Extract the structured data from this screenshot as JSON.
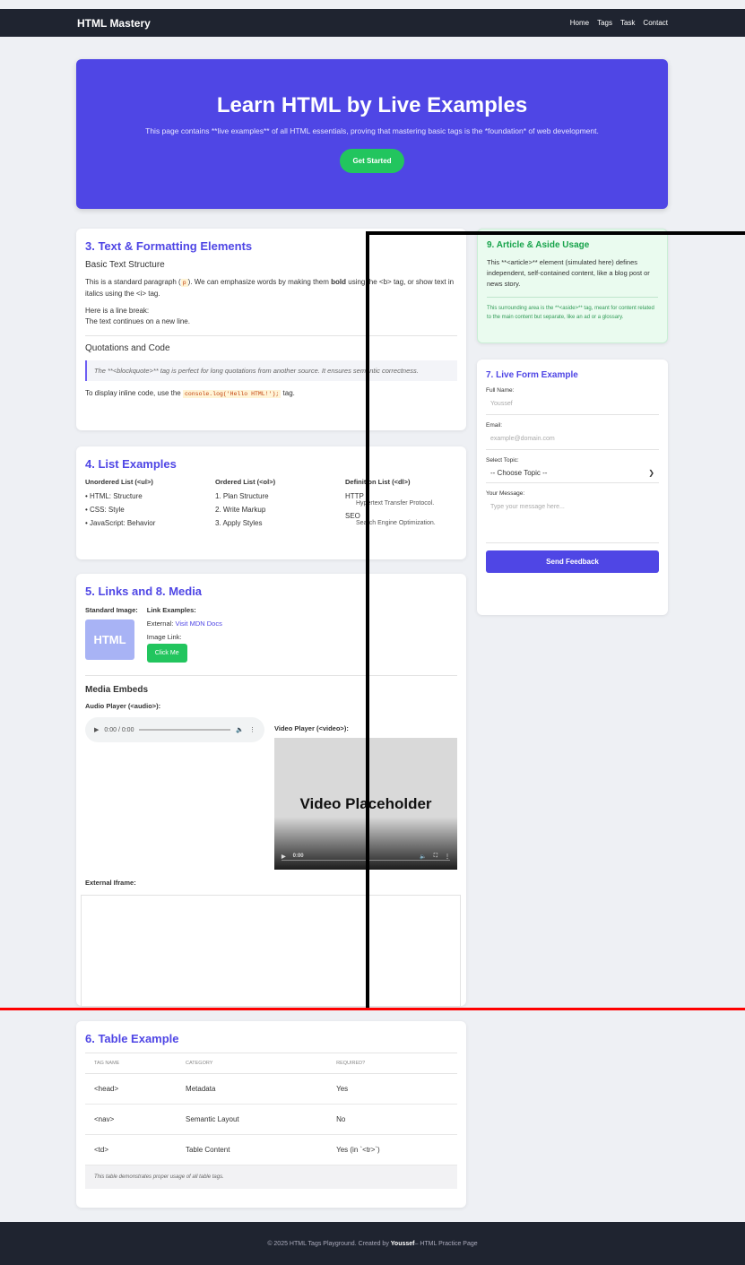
{
  "header": {
    "brand": "HTML Mastery",
    "nav": [
      "Home",
      "Tags",
      "Task",
      "Contact"
    ]
  },
  "hero": {
    "title": "Learn HTML by Live Examples",
    "subtitle": "This page contains **live examples** of all HTML essentials, proving that mastering basic tags is the *foundation* of web development.",
    "cta": "Get Started"
  },
  "text_section": {
    "title": "3. Text & Formatting Elements",
    "basic_heading": "Basic Text Structure",
    "para1_a": "This is a standard paragraph (",
    "para1_code": "p",
    "para1_b": "). We can emphasize words by making them ",
    "para1_bold": "bold",
    "para1_c": " using the <b> tag, or show text in italics using the <i> tag.",
    "br1": "Here is a line break:",
    "br2": "The text continues on a new line.",
    "quote_heading": "Quotations and Code",
    "blockquote": "The **<blockquote>** tag is perfect for long quotations from another source. It ensures semantic correctness.",
    "inline_a": "To display inline code, use the ",
    "inline_code": "console.log('Hello HTML!');",
    "inline_b": " tag."
  },
  "lists": {
    "title": "4. List Examples",
    "ul_heading": "Unordered List (<ul>)",
    "ul_items": [
      "HTML: Structure",
      "CSS: Style",
      "JavaScript: Behavior"
    ],
    "ol_heading": "Ordered List (<ol>)",
    "ol_items": [
      "1. Plan Structure",
      "2. Write Markup",
      "3. Apply Styles"
    ],
    "dl_heading": "Definition List (<dl>)",
    "dl_terms": [
      {
        "term": "HTTP",
        "def": "Hypertext Transfer Protocol."
      },
      {
        "term": "SEO",
        "def": "Search Engine Optimization."
      }
    ]
  },
  "media": {
    "title": "5. Links and 8. Media",
    "std_image": "Standard Image:",
    "img_text": "HTML",
    "link_examples": "Link Examples:",
    "external_label": "External:",
    "external_link": "Visit MDN Docs",
    "image_link_label": "Image Link:",
    "click_me": "Click Me",
    "embeds_heading": "Media Embeds",
    "audio_label": "Audio Player (<audio>):",
    "audio_time": "0:00 / 0:00",
    "video_label": "Video Player (<video>):",
    "video_placeholder": "Video Placeholder",
    "video_time": "0:00",
    "iframe_label": "External Iframe:"
  },
  "aside": {
    "title": "9. Article & Aside Usage",
    "article_text": "This **<article>** element (simulated here) defines independent, self-contained content, like a blog post or news story.",
    "aside_text": "This surrounding area is the **<aside>** tag, meant for content related to the main content but separate, like an ad or a glossary."
  },
  "form": {
    "title": "7. Live Form Example",
    "name_label": "Full Name:",
    "name_value": "Youssef",
    "email_label": "Email:",
    "email_placeholder": "example@domain.com",
    "topic_label": "Select Topic:",
    "topic_value": "-- Choose Topic --",
    "message_label": "Your Message:",
    "message_placeholder": "Type your message here...",
    "submit": "Send Feedback"
  },
  "table": {
    "title": "6. Table Example",
    "headers": [
      "TAG NAME",
      "CATEGORY",
      "REQUIRED?"
    ],
    "rows": [
      [
        "<head>",
        "Metadata",
        "Yes"
      ],
      [
        "<nav>",
        "Semantic Layout",
        "No"
      ],
      [
        "<td>",
        "Table Content",
        "Yes (in `<tr>`)"
      ]
    ],
    "caption": "This table demonstrates proper usage of all table tags."
  },
  "footer": {
    "text_a": "© 2025 HTML Tags Playground. Created by ",
    "author": "Youssef",
    "text_b": " – HTML Practice Page"
  },
  "colors": {
    "primary": "#4f46e5",
    "success": "#22c55e",
    "dark": "#1f2430",
    "aside_bg": "#eafbef"
  }
}
